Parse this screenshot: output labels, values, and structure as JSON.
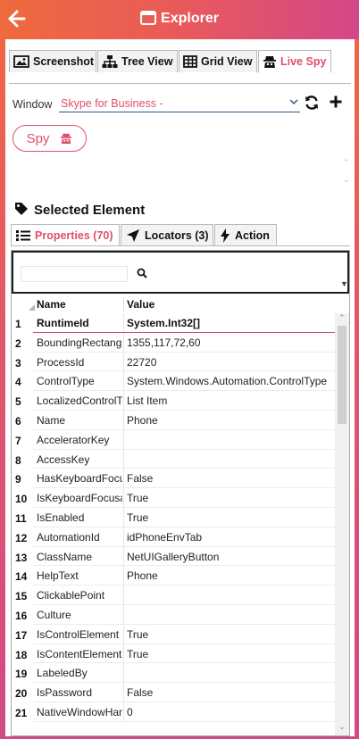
{
  "app": {
    "title": "Explorer"
  },
  "main_tabs": [
    {
      "label": "Screenshot",
      "icon": "image-icon"
    },
    {
      "label": "Tree View",
      "icon": "tree-icon"
    },
    {
      "label": "Grid View",
      "icon": "grid-icon"
    },
    {
      "label": "Live Spy",
      "icon": "spy-icon",
      "active": true
    }
  ],
  "window_selector": {
    "label": "Window",
    "value": "Skype for Business  -"
  },
  "spy_button": {
    "label": "Spy"
  },
  "selected_element": {
    "title": "Selected Element"
  },
  "sub_tabs": [
    {
      "label": "Properties (70)",
      "icon": "list-icon",
      "active": true
    },
    {
      "label": "Locators (3)",
      "icon": "locator-arrow-icon"
    },
    {
      "label": "Action",
      "icon": "lightning-icon"
    }
  ],
  "grid": {
    "search_value": "",
    "columns": {
      "name": "Name",
      "value": "Value"
    },
    "rows": [
      {
        "n": "1",
        "name": "RuntimeId",
        "value": "System.Int32[]"
      },
      {
        "n": "2",
        "name": "BoundingRectangle",
        "value": "1355,117,72,60"
      },
      {
        "n": "3",
        "name": "ProcessId",
        "value": "22720"
      },
      {
        "n": "4",
        "name": "ControlType",
        "value": "System.Windows.Automation.ControlType"
      },
      {
        "n": "5",
        "name": "LocalizedControlType",
        "value": "List Item"
      },
      {
        "n": "6",
        "name": "Name",
        "value": "Phone"
      },
      {
        "n": "7",
        "name": "AcceleratorKey",
        "value": ""
      },
      {
        "n": "8",
        "name": "AccessKey",
        "value": ""
      },
      {
        "n": "9",
        "name": "HasKeyboardFocus",
        "value": "False"
      },
      {
        "n": "10",
        "name": "IsKeyboardFocusable",
        "value": "True"
      },
      {
        "n": "11",
        "name": "IsEnabled",
        "value": "True"
      },
      {
        "n": "12",
        "name": "AutomationId",
        "value": "idPhoneEnvTab"
      },
      {
        "n": "13",
        "name": "ClassName",
        "value": "NetUIGalleryButton"
      },
      {
        "n": "14",
        "name": "HelpText",
        "value": "Phone"
      },
      {
        "n": "15",
        "name": "ClickablePoint",
        "value": ""
      },
      {
        "n": "16",
        "name": "Culture",
        "value": ""
      },
      {
        "n": "17",
        "name": "IsControlElement",
        "value": "True"
      },
      {
        "n": "18",
        "name": "IsContentElement",
        "value": "True"
      },
      {
        "n": "19",
        "name": "LabeledBy",
        "value": ""
      },
      {
        "n": "20",
        "name": "IsPassword",
        "value": "False"
      },
      {
        "n": "21",
        "name": "NativeWindowHandle",
        "value": "0"
      }
    ]
  },
  "colors": {
    "accent": "#e0506a",
    "gradient_start": "#ef6a3d",
    "gradient_end": "#d4478a"
  }
}
